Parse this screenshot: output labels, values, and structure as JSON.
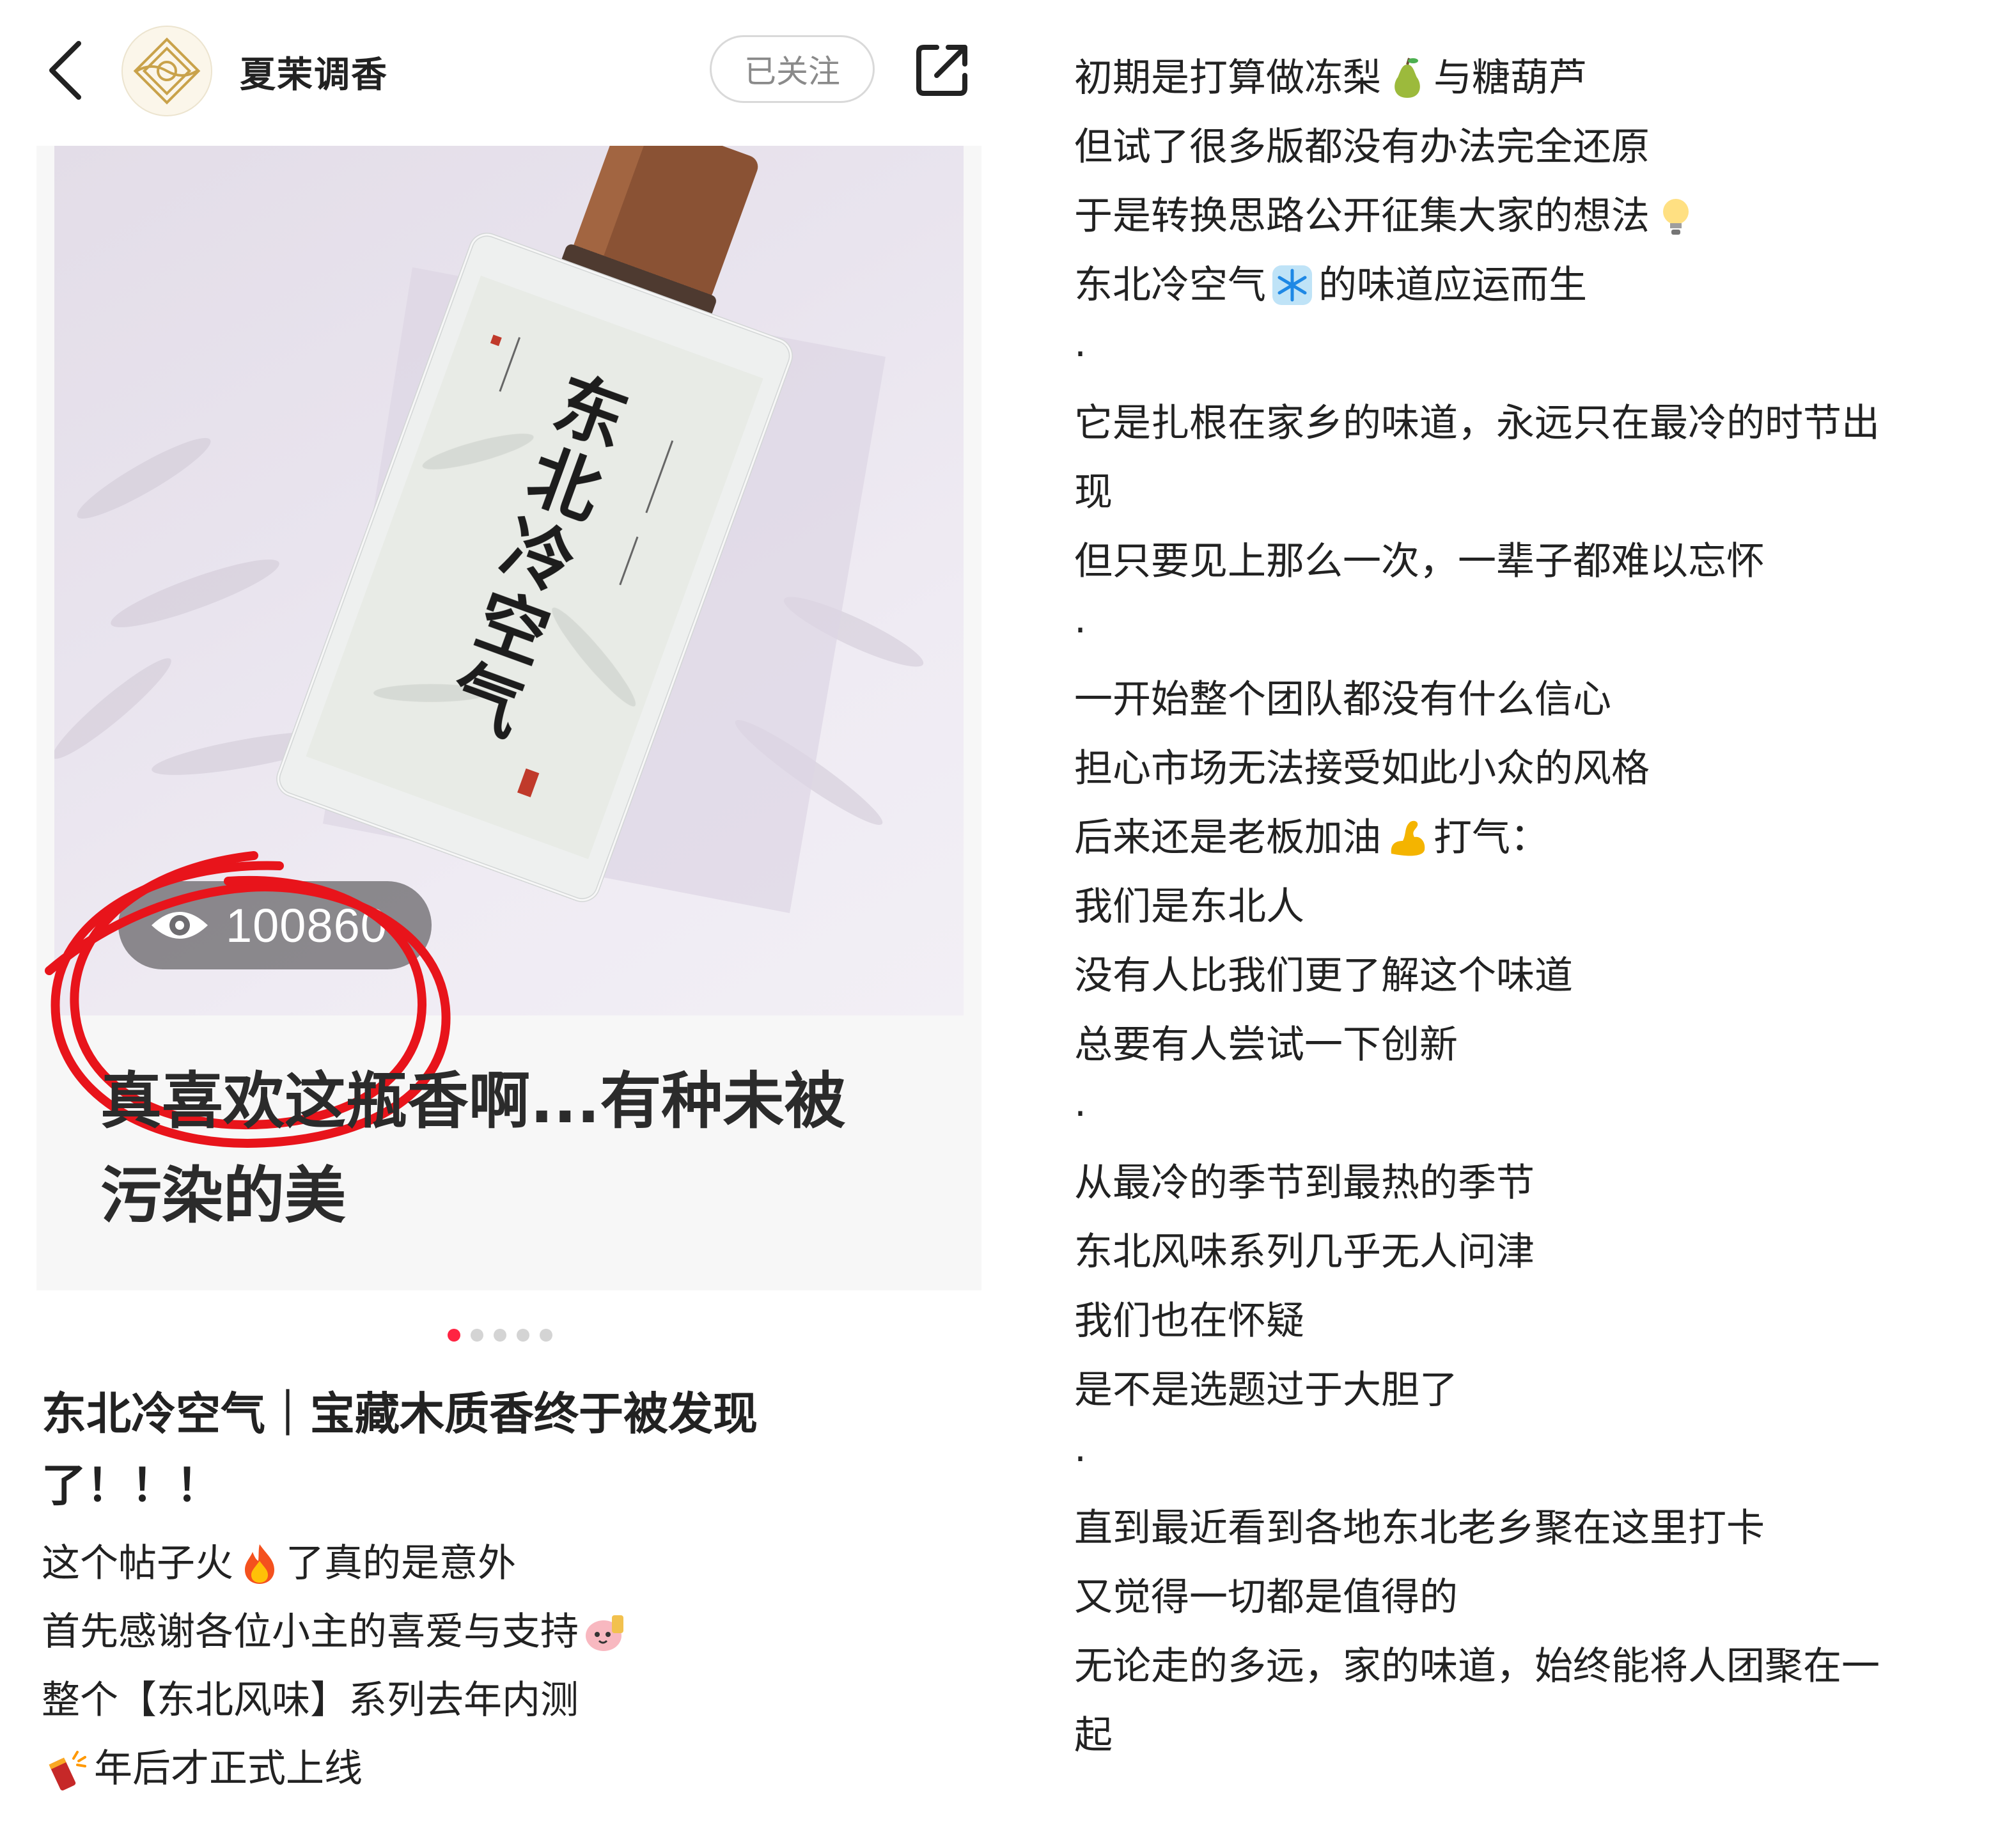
{
  "header": {
    "author_name": "夏茉调香",
    "follow_label": "已关注",
    "icons": [
      "back-icon",
      "share-icon"
    ]
  },
  "cover": {
    "bottle_label": "东北冷空气",
    "view_count": "100860",
    "caption_line1": "真喜欢这瓶香啊...有种未被",
    "caption_line2": "污染的美"
  },
  "carousel": {
    "total": 5,
    "active_index": 0
  },
  "post": {
    "title_line1": "东北冷空气｜宝藏木质香终于被发现",
    "title_line2": "了！！！",
    "body_left": [
      {
        "text": "这个帖子火",
        "emoji": "fire-emoji",
        "after": "了真的是意外"
      },
      {
        "text": "首先感谢各位小主的喜爱与支持",
        "emoji": "sticker-emoji",
        "after": ""
      },
      {
        "text": "整个【东北风味】系列去年内测",
        "emoji": "",
        "after": ""
      },
      {
        "text": "",
        "emoji": "firecracker-emoji",
        "after": "年后才正式上线"
      }
    ],
    "body_right": [
      {
        "text": "初期是打算做冻梨",
        "emoji": "pear-emoji",
        "after": "与糖葫芦"
      },
      {
        "text": "但试了很多版都没有办法完全还原",
        "emoji": "",
        "after": ""
      },
      {
        "text": "于是转换思路公开征集大家的想法",
        "emoji": "bulb-emoji",
        "after": ""
      },
      {
        "text": "东北冷空气",
        "emoji": "snowflake-emoji",
        "after": "的味道应运而生"
      },
      {
        "text": "·",
        "emoji": "",
        "after": ""
      },
      {
        "text": "它是扎根在家乡的味道，永远只在最冷的时节出",
        "emoji": "",
        "after": ""
      },
      {
        "text": "现",
        "emoji": "",
        "after": ""
      },
      {
        "text": "但只要见上那么一次，一辈子都难以忘怀",
        "emoji": "",
        "after": ""
      },
      {
        "text": "·",
        "emoji": "",
        "after": ""
      },
      {
        "text": "一开始整个团队都没有什么信心",
        "emoji": "",
        "after": ""
      },
      {
        "text": "担心市场无法接受如此小众的风格",
        "emoji": "",
        "after": ""
      },
      {
        "text": "后来还是老板加油",
        "emoji": "muscle-emoji",
        "after": "打气："
      },
      {
        "text": "我们是东北人",
        "emoji": "",
        "after": ""
      },
      {
        "text": "没有人比我们更了解这个味道",
        "emoji": "",
        "after": ""
      },
      {
        "text": "总要有人尝试一下创新",
        "emoji": "",
        "after": ""
      },
      {
        "text": "·",
        "emoji": "",
        "after": ""
      },
      {
        "text": "从最冷的季节到最热的季节",
        "emoji": "",
        "after": ""
      },
      {
        "text": "东北风味系列几乎无人问津",
        "emoji": "",
        "after": ""
      },
      {
        "text": "我们也在怀疑",
        "emoji": "",
        "after": ""
      },
      {
        "text": "是不是选题过于大胆了",
        "emoji": "",
        "after": ""
      },
      {
        "text": "·",
        "emoji": "",
        "after": ""
      },
      {
        "text": "直到最近看到各地东北老乡聚在这里打卡",
        "emoji": "",
        "after": ""
      },
      {
        "text": "又觉得一切都是值得的",
        "emoji": "",
        "after": ""
      },
      {
        "text": "无论走的多远，家的味道，始终能将人团聚在一",
        "emoji": "",
        "after": ""
      },
      {
        "text": "起",
        "emoji": "",
        "after": ""
      }
    ]
  },
  "colors": {
    "accent": "#ff2442",
    "annotation_circle": "#e8141b",
    "text": "#222222",
    "muted": "#8a8a8a"
  }
}
